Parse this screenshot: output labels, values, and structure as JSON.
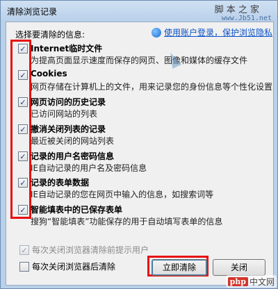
{
  "window": {
    "title": "清除浏览记录"
  },
  "watermark_top": {
    "text1": "脚 本 之 家",
    "badge": "之 家",
    "url": "www.Jb51.net"
  },
  "section_label": "选择要清除的信息:",
  "account_link": {
    "icon": "sogou-account-icon",
    "text": "使用账户登录，保护浏览隐私"
  },
  "items": [
    {
      "title": "Internet临时文件",
      "desc": "为提高页面显示速度而保存的网页、图像和媒体的缓存文件",
      "checked": "✓"
    },
    {
      "title": "Cookies",
      "desc": "网页存储在计算机上的文件，用来记录您的身份信息等个性化设置",
      "checked": "✓"
    },
    {
      "title": "网页访问的历史记录",
      "desc": "已访问网站的列表",
      "checked": "✓"
    },
    {
      "title": "撤消关闭列表的记录",
      "desc": "最近被关闭的网站列表",
      "checked": "✓"
    },
    {
      "title": "记录的用户名密码信息",
      "desc": "IE自动记录的用户名及密码信息",
      "checked": "✓"
    },
    {
      "title": "记录的表单数据",
      "desc": "IE自动记录的您在网页中输入的信息，如搜索词等",
      "checked": "✓"
    },
    {
      "title": "智能填表中的已保存表单",
      "desc": "搜狗“智能填表”功能保存的用于自动填写表单的信息",
      "checked": "✓"
    }
  ],
  "bottom": {
    "prompt_on_close": {
      "label": "每次关闭浏览器清除前提示用户",
      "checked": "✓",
      "enabled": false
    },
    "clear_on_close": {
      "label": "每次关闭浏览器后清除",
      "checked": ""
    }
  },
  "buttons": {
    "clear_now": "立即清除",
    "close": "关闭"
  },
  "watermark_bottom": {
    "logo": "php",
    "text": "中文网"
  },
  "colors": {
    "highlight": "#e81010",
    "link": "#0b52c8",
    "frame": "#b9d0ea"
  }
}
